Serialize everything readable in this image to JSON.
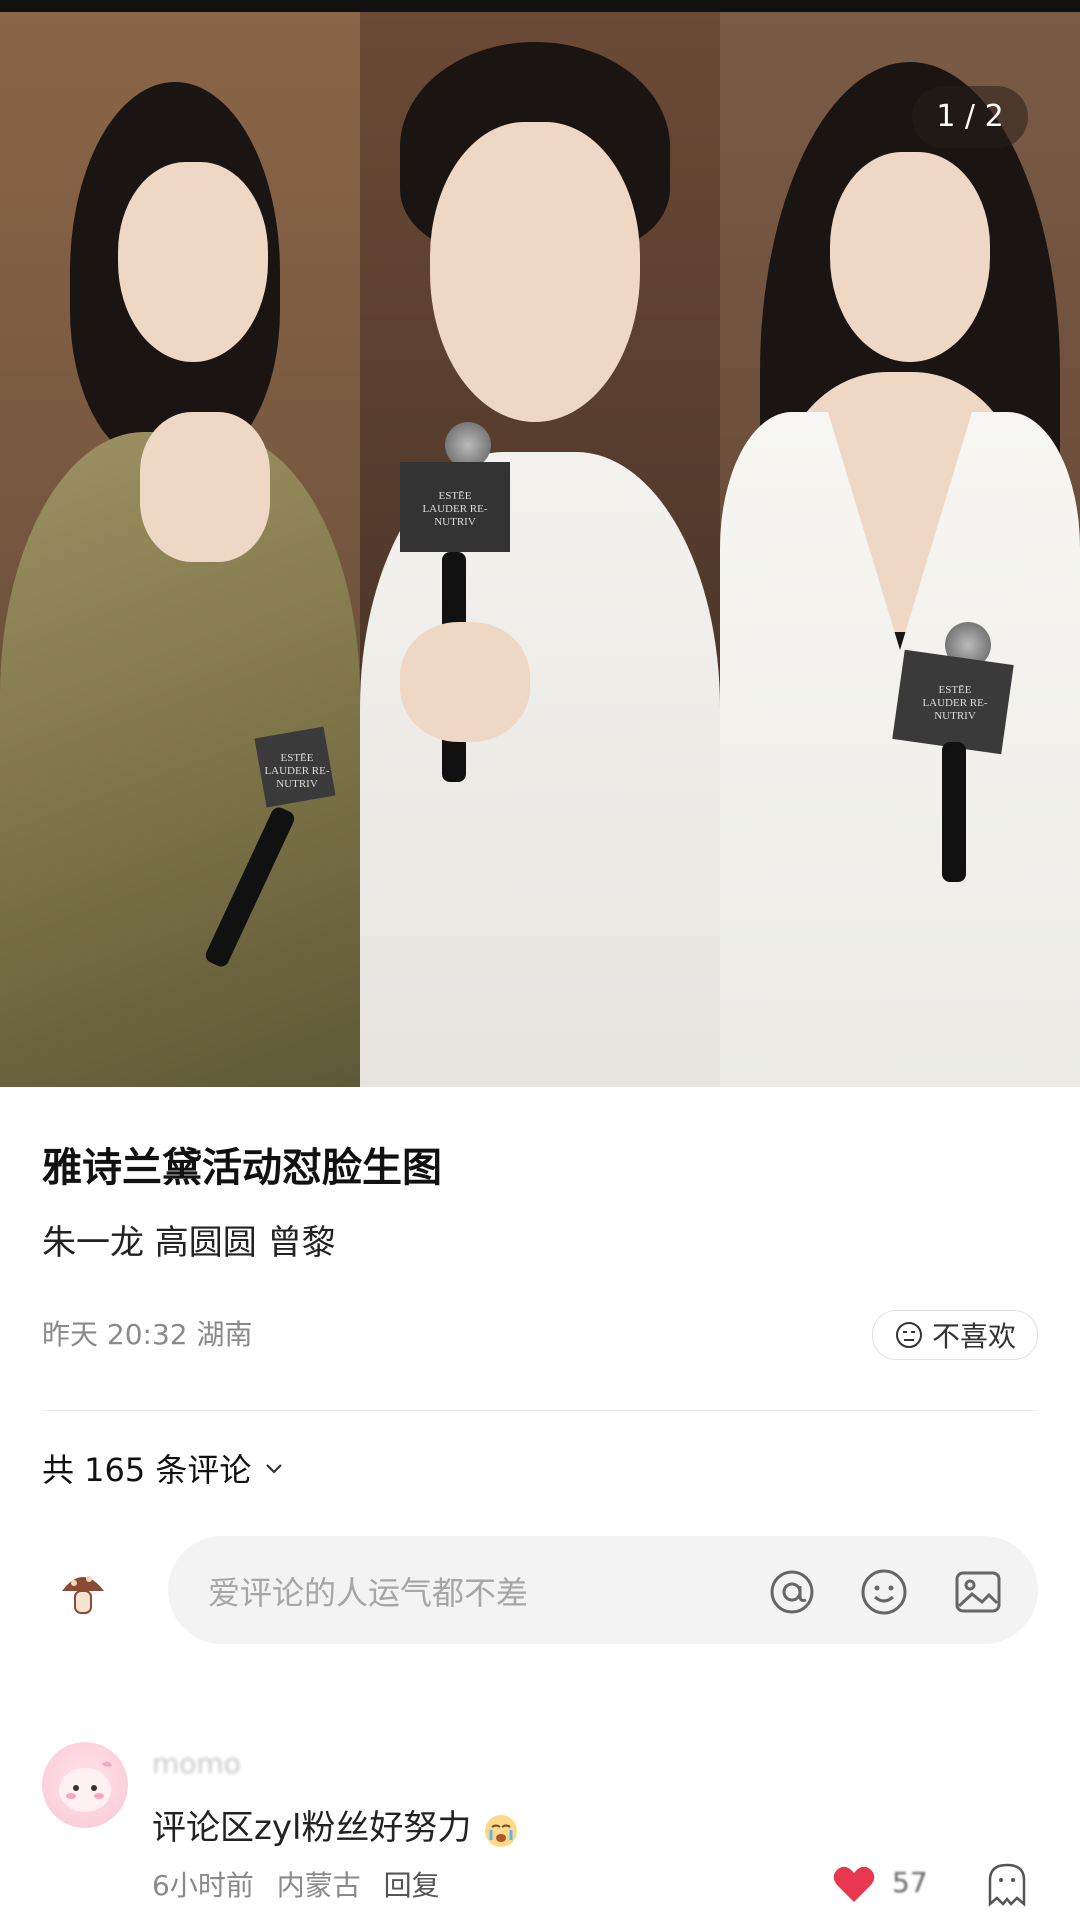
{
  "gallery": {
    "counter": "1 / 2",
    "photos": [
      {
        "mic_label": "ESTĒE LAUDER RE-NUTRIV"
      },
      {
        "mic_label": "ESTĒE LAUDER RE-NUTRIV"
      },
      {
        "mic_label": "ESTĒE LAUDER RE-NUTRIV"
      }
    ]
  },
  "post": {
    "title": "雅诗兰黛活动怼脸生图",
    "subtitle": "朱一龙 高圆圆 曾黎",
    "time": "昨天 20:32",
    "location": "湖南",
    "dislike_label": "不喜欢"
  },
  "comments": {
    "count_label": "共 165 条评论",
    "input_placeholder": "爱评论的人运气都不差",
    "items": [
      {
        "user": "momo",
        "text": "评论区zyl粉丝好努力",
        "time": "6小时前",
        "location": "内蒙古",
        "reply_label": "回复",
        "likes": "57"
      }
    ]
  },
  "colors": {
    "heart": "#e8384f",
    "placeholder": "#a6a6a6",
    "meta": "#8a8a8a"
  },
  "icons": [
    "neutral-face-icon",
    "chevron-down-icon",
    "mushroom-avatar-icon",
    "at-icon",
    "emoji-icon",
    "image-icon",
    "heart-icon",
    "ghost-icon",
    "crying-emoji-icon"
  ]
}
